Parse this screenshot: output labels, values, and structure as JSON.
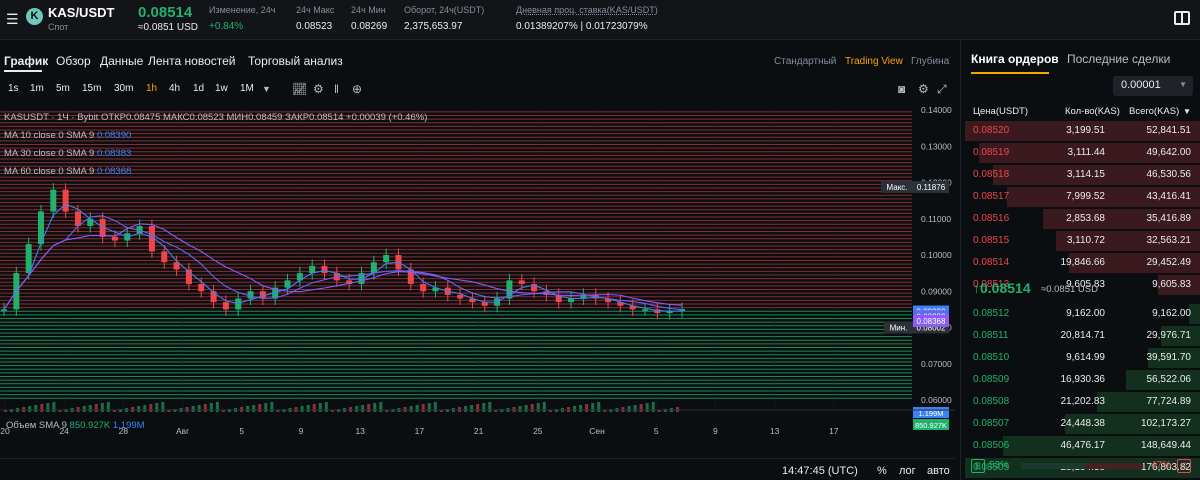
{
  "topbar": {
    "pair": "KAS/USDT",
    "sub": "Спот",
    "coin_icon": "K",
    "price": "0.08514",
    "price_usd": "≈0.0851 USD",
    "stats": [
      {
        "label": "Изменение, 24ч",
        "value": "+0.84%",
        "color": "green"
      },
      {
        "label": "24ч Макс",
        "value": "0.08523"
      },
      {
        "label": "24ч Мин",
        "value": "0.08269"
      },
      {
        "label": "Оборот, 24ч(USDT)",
        "value": "2,375,653.97"
      },
      {
        "label": "Дневная проц. ставка(KAS/USDT)",
        "value": "0.01389207% | 0.01723079%"
      }
    ]
  },
  "tabs": [
    "График",
    "Обзор",
    "Данные",
    "Лента новостей",
    "Торговый анализ"
  ],
  "views": [
    "Стандартный",
    "Trading View",
    "Глубина"
  ],
  "timeframes": [
    "1s",
    "1m",
    "5m",
    "15m",
    "30m",
    "1h",
    "4h",
    "1d",
    "1w",
    "1M"
  ],
  "active_timeframe": "1h",
  "toolbar_icons": [
    "chevron-down-icon",
    "line-chart-icon",
    "indicator-icon",
    "candles-icon",
    "plus-icon"
  ],
  "chart_tools": [
    "camera-icon",
    "settings-icon",
    "fullscreen-icon"
  ],
  "legend": {
    "ohlc": "KASUSDT · 1Ч · Bybit  ОТКР0.08475  МАКС0.08523  МИН0.08459  ЗАКР0.08514  +0.00039 (+0.46%)",
    "ma": [
      {
        "label": "MA 10 close 0 SMA 9",
        "value": "0.08390"
      },
      {
        "label": "MA 30 close 0 SMA 9",
        "value": "0.08383"
      },
      {
        "label": "MA 60 close 0 SMA 9",
        "value": "0.08368"
      }
    ],
    "volume": "Объем SMA 9",
    "vol1": "850.927K",
    "vol2": "1.199M"
  },
  "chart_data": {
    "type": "candlestick",
    "yaxis_ticks": [
      "0.14000",
      "0.13000",
      "0.12000",
      "0.11000",
      "0.10000",
      "0.09000",
      "0.08000",
      "0.07000",
      "0.06000"
    ],
    "ylim": [
      0.06,
      0.14
    ],
    "x_ticks": [
      "20",
      "24",
      "28",
      "Авг",
      "5",
      "9",
      "13",
      "17",
      "21",
      "25",
      "Сен",
      "5",
      "9",
      "13",
      "17"
    ],
    "max_label": "Макс.",
    "max_value": "0.11876",
    "min_label": "Мин.",
    "min_value": "0.08002",
    "ma_values": [
      "0.08390",
      "0.08383",
      "0.08368"
    ],
    "close": "0.08514",
    "vol_badges": [
      "1.199M",
      "850.927K"
    ],
    "series_close": [
      0.085,
      0.095,
      0.103,
      0.112,
      0.118,
      0.112,
      0.108,
      0.11,
      0.105,
      0.104,
      0.106,
      0.108,
      0.101,
      0.098,
      0.096,
      0.092,
      0.09,
      0.087,
      0.085,
      0.088,
      0.09,
      0.088,
      0.091,
      0.093,
      0.095,
      0.097,
      0.095,
      0.093,
      0.092,
      0.095,
      0.098,
      0.1,
      0.096,
      0.092,
      0.09,
      0.091,
      0.089,
      0.088,
      0.087,
      0.086,
      0.088,
      0.093,
      0.092,
      0.09,
      0.089,
      0.087,
      0.088,
      0.089,
      0.088,
      0.087,
      0.086,
      0.085,
      0.085,
      0.084,
      0.0845,
      0.0851
    ]
  },
  "bottom": {
    "time": "14:47:45 (UTC)",
    "pct": "%",
    "log": "лог",
    "auto": "авто"
  },
  "orderbook": {
    "tabs": [
      "Книга ордеров",
      "Последние сделки"
    ],
    "precision": "0.00001",
    "headers": [
      "Цена(USDT)",
      "Кол-во(KAS)",
      "Всего(KAS)"
    ],
    "asks": [
      {
        "p": "0.08520",
        "q": "3,199.51",
        "t": "52,841.51"
      },
      {
        "p": "0.08519",
        "q": "3,111.44",
        "t": "49,642.00"
      },
      {
        "p": "0.08518",
        "q": "3,114.15",
        "t": "46,530.56"
      },
      {
        "p": "0.08517",
        "q": "7,999.52",
        "t": "43,416.41"
      },
      {
        "p": "0.08516",
        "q": "2,853.68",
        "t": "35,416.89"
      },
      {
        "p": "0.08515",
        "q": "3,110.72",
        "t": "32,563.21"
      },
      {
        "p": "0.08514",
        "q": "19,846.66",
        "t": "29,452.49"
      },
      {
        "p": "0.08513",
        "q": "9,605.83",
        "t": "9,605.83"
      }
    ],
    "mid_price": "↑0.08514",
    "mid_usd": "≈0.0851 USD",
    "bids": [
      {
        "p": "0.08512",
        "q": "9,162.00",
        "t": "9,162.00"
      },
      {
        "p": "0.08511",
        "q": "20,814.71",
        "t": "29,976.71"
      },
      {
        "p": "0.08510",
        "q": "9,614.99",
        "t": "39,591.70"
      },
      {
        "p": "0.08509",
        "q": "16,930.36",
        "t": "56,522.06"
      },
      {
        "p": "0.08508",
        "q": "21,202.83",
        "t": "77,724.89"
      },
      {
        "p": "0.08507",
        "q": "24,448.38",
        "t": "102,173.27"
      },
      {
        "p": "0.08506",
        "q": "46,476.17",
        "t": "148,649.44"
      },
      {
        "p": "0.08505",
        "q": "28,154.38",
        "t": "176,803.82"
      }
    ],
    "buy_label": "B",
    "buy_pct": "53%",
    "sell_label": "S",
    "sell_pct": "47%"
  }
}
